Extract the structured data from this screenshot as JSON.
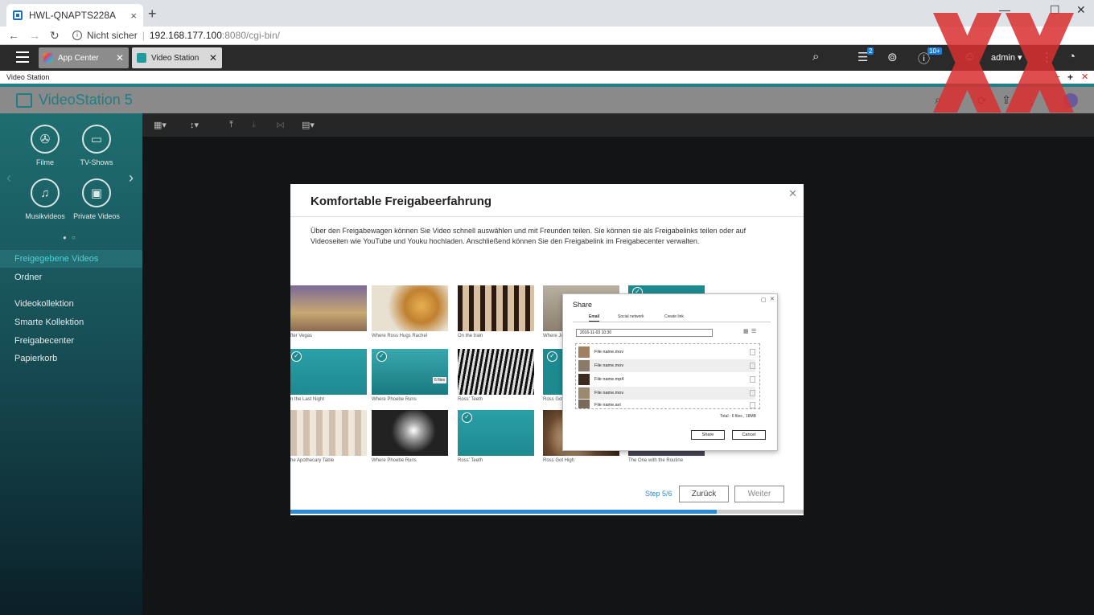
{
  "browser": {
    "tab_title": "HWL-QNAPTS228A",
    "close": "×",
    "newtab": "+",
    "security": "Nicht sicher",
    "url_host": "192.168.177.100",
    "url_rest": ":8080/cgi-bin/"
  },
  "qts": {
    "tabs": [
      {
        "label": "App Center",
        "icon_color": "#f0a020"
      },
      {
        "label": "Video Station",
        "icon_color": "#1e9aa0"
      }
    ],
    "user": "admin ▾",
    "badges": {
      "tasks": "2",
      "notifications": "10+"
    }
  },
  "app": {
    "window_label": "Video Station",
    "title": "VideoStation 5"
  },
  "sidebar": {
    "categories": [
      {
        "label": "Filme",
        "icon": "film-reel-icon"
      },
      {
        "label": "TV-Shows",
        "icon": "tv-icon"
      },
      {
        "label": "Musikvideos",
        "icon": "music-video-icon"
      },
      {
        "label": "Private Videos",
        "icon": "camcorder-icon"
      }
    ],
    "menu": [
      "Freigegebene Videos",
      "Ordner",
      "Videokollektion",
      "Smarte Kollektion",
      "Freigabecenter",
      "Papierkorb"
    ],
    "active_index": 0
  },
  "modal": {
    "title": "Komfortable Freigabeerfahrung",
    "text": "Über den Freigabewagen können Sie Video schnell auswählen und mit Freunden teilen. Sie können sie als Freigabelinks teilen oder auf Videoseiten wie YouTube und Youku hochladen. Anschließend können Sie den Freigabelink im Freigabecenter verwalten.",
    "captions": [
      "fter Vegas",
      "Where Ross Hugs Rachel",
      "On the train",
      "Where Jo",
      "n the Last Night",
      "Where Phoebe Runs",
      "Ross' Teeth",
      "Ross Got H",
      "he Apothecary Table",
      "Where Phoebe Runs",
      "Ross' Teeth",
      "Ross Got High",
      "The One with the Routine"
    ],
    "files_badge": "6 files",
    "share": {
      "title": "Share",
      "tabs": [
        "Email",
        "Social network",
        "Create link"
      ],
      "date": "2016-11-03 10:30",
      "files": [
        "File name.mov",
        "File name.mov",
        "File name.mp4",
        "File name.mov",
        "File name.avi"
      ],
      "total": "Total : 6 files , 18MB",
      "share_btn": "Share",
      "cancel_btn": "Cancel"
    },
    "step": "Step 5/6",
    "back": "Zurück",
    "next": "Weiter",
    "progress": 0.83
  }
}
